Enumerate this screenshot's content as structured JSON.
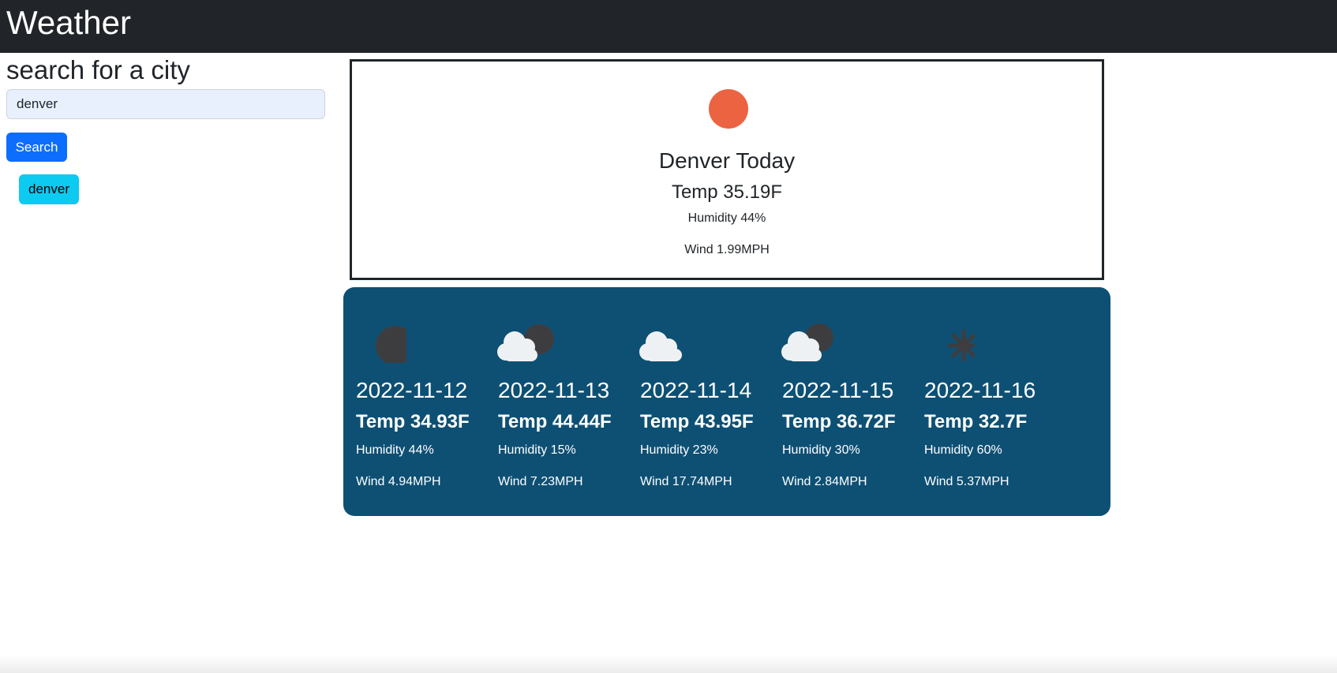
{
  "header": {
    "title": "Weather"
  },
  "sidebar": {
    "heading": "search for a city",
    "search_value": "denver",
    "search_button": "Search",
    "history": [
      "denver"
    ]
  },
  "today": {
    "icon": "sun-icon",
    "city": "Denver Today",
    "temp": "Temp 35.19F",
    "humidity": "Humidity 44%",
    "wind": "Wind 1.99MPH",
    "icon_color": "#ec6342"
  },
  "forecast": [
    {
      "icon": "moon-icon",
      "date": "2022-11-12",
      "temp": "Temp 34.93F",
      "humidity": "Humidity 44%",
      "wind": "Wind 4.94MPH"
    },
    {
      "icon": "cloud-moon-icon",
      "date": "2022-11-13",
      "temp": "Temp 44.44F",
      "humidity": "Humidity 15%",
      "wind": "Wind 7.23MPH"
    },
    {
      "icon": "cloud-icon",
      "date": "2022-11-14",
      "temp": "Temp 43.95F",
      "humidity": "Humidity 23%",
      "wind": "Wind 17.74MPH"
    },
    {
      "icon": "cloud-moon-icon",
      "date": "2022-11-15",
      "temp": "Temp 36.72F",
      "humidity": "Humidity 30%",
      "wind": "Wind 2.84MPH"
    },
    {
      "icon": "snowflake-icon",
      "date": "2022-11-16",
      "temp": "Temp 32.7F",
      "humidity": "Humidity 60%",
      "wind": "Wind 5.37MPH"
    }
  ],
  "colors": {
    "navbar": "#212529",
    "primary": "#0d6efd",
    "info": "#0dcaf0",
    "forecast_bg": "#0e5074"
  }
}
